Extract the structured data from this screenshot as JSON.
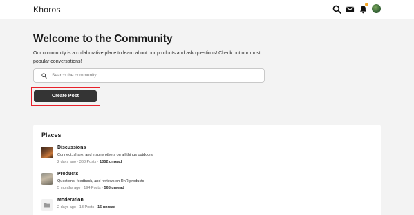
{
  "header": {
    "logo": "Khoros",
    "logo_mark": "",
    "icons": [
      "search-icon",
      "mail-icon",
      "bell-icon",
      "user-avatar"
    ],
    "notification_dot_color": "#f5a623"
  },
  "welcome": {
    "title": "Welcome to the Community",
    "description": "Our community is a collaborative place to learn about our products and ask questions! Check out our most popular conversations!"
  },
  "search": {
    "placeholder": "Search the community",
    "value": ""
  },
  "create_post": {
    "label": "Create Post",
    "highlight_color": "#e8202a"
  },
  "places": {
    "title": "Places",
    "items": [
      {
        "name": "Discussions",
        "description": "Connect, share, and inspire others on all things outdoors.",
        "meta_prefix": "2 days ago · 368 Posts · ",
        "unread": "1052 unread"
      },
      {
        "name": "Products",
        "description": "Questions, feedback, and reviews on RnR products",
        "meta_prefix": "5 months ago · 194 Posts · ",
        "unread": "568 unread"
      },
      {
        "name": "Moderation",
        "description": "",
        "meta_prefix": "2 days ago · 13 Posts · ",
        "unread": "15 unread"
      }
    ]
  }
}
